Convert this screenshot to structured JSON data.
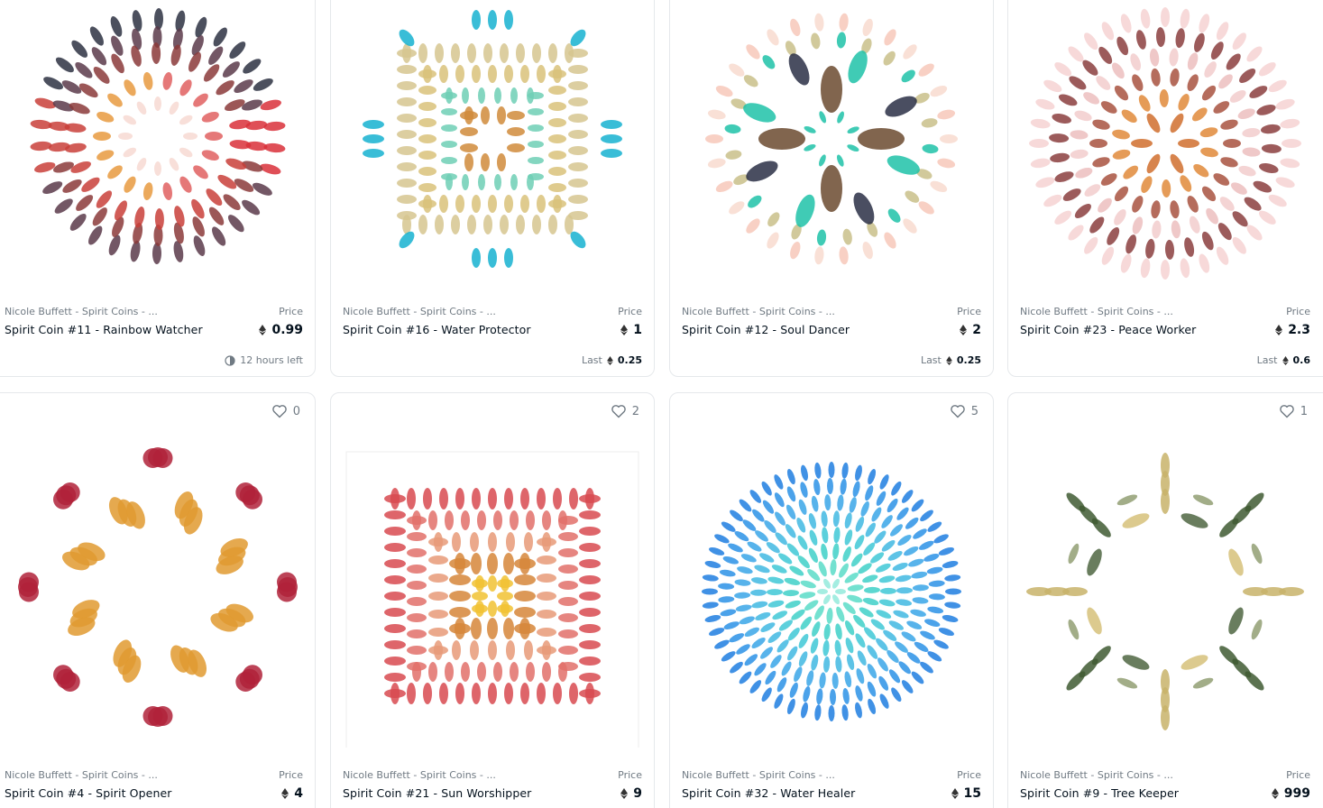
{
  "colors": {
    "border": "#e5e8eb",
    "muted_text": "#707a83",
    "main_text": "#04111d"
  },
  "cards": [
    {
      "collection": "Nicole Buffett - Spirit Coins - ...",
      "name": "Spirit Coin #11 - Rainbow Watcher",
      "price_label": "Price",
      "price": "0.99",
      "footer_text": "12 hours left",
      "footer_icon": "clock-icon"
    },
    {
      "collection": "Nicole Buffett - Spirit Coins - ...",
      "name": "Spirit Coin #16 - Water Protector",
      "price_label": "Price",
      "price": "1",
      "last_label": "Last",
      "last_price": "0.25"
    },
    {
      "collection": "Nicole Buffett - Spirit Coins - ...",
      "name": "Spirit Coin #12 - Soul Dancer",
      "price_label": "Price",
      "price": "2",
      "last_label": "Last",
      "last_price": "0.25"
    },
    {
      "collection": "Nicole Buffett - Spirit Coins - ...",
      "name": "Spirit Coin #23 - Peace Worker",
      "price_label": "Price",
      "price": "2.3",
      "last_label": "Last",
      "last_price": "0.6"
    },
    {
      "favorites": "0",
      "collection": "Nicole Buffett - Spirit Coins - ...",
      "name": "Spirit Coin #4 - Spirit Opener",
      "price_label": "Price",
      "price": "4"
    },
    {
      "favorites": "2",
      "collection": "Nicole Buffett - Spirit Coins - ...",
      "name": "Spirit Coin #21 - Sun Worshipper",
      "price_label": "Price",
      "price": "9"
    },
    {
      "favorites": "5",
      "collection": "Nicole Buffett - Spirit Coins - ...",
      "name": "Spirit Coin #32 - Water Healer",
      "price_label": "Price",
      "price": "15"
    },
    {
      "favorites": "1",
      "collection": "Nicole Buffett - Spirit Coins - ...",
      "name": "Spirit Coin #9 - Tree Keeper",
      "price_label": "Price",
      "price": "999"
    }
  ]
}
